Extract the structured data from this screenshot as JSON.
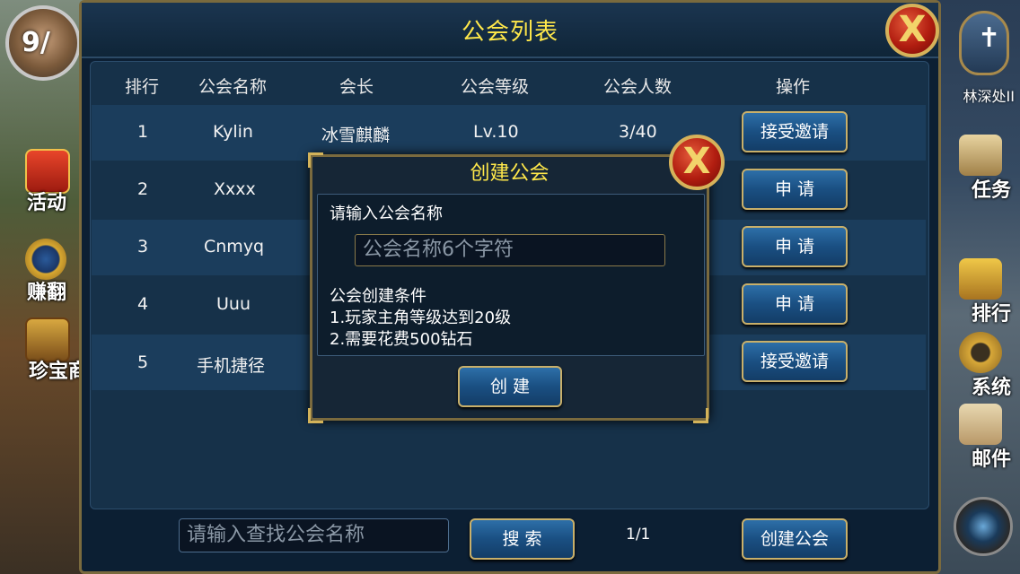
{
  "title": "公会列表",
  "close_symbol": "X",
  "left_side": {
    "avatar_logo": "9/",
    "items": [
      {
        "label": "活动"
      },
      {
        "label": "赚翻"
      },
      {
        "label": "珍宝商"
      }
    ]
  },
  "right_side": {
    "badge_label": "林深处II",
    "items": [
      {
        "label": "任务"
      },
      {
        "label": "排行"
      },
      {
        "label": "系统"
      },
      {
        "label": "邮件"
      }
    ]
  },
  "table": {
    "headers": [
      "排行",
      "公会名称",
      "会长",
      "公会等级",
      "公会人数",
      "操作"
    ],
    "rows": [
      {
        "rank": "1",
        "name": "Kylin",
        "leader": "冰雪麒麟",
        "level": "Lv.10",
        "members": "3/40",
        "action": "接受邀请"
      },
      {
        "rank": "2",
        "name": "Xxxx",
        "leader": "",
        "level": "",
        "members": "",
        "action": "申  请"
      },
      {
        "rank": "3",
        "name": "Cnmyq",
        "leader": "",
        "level": "",
        "members": "",
        "action": "申  请"
      },
      {
        "rank": "4",
        "name": "Uuu",
        "leader": "",
        "level": "",
        "members": "",
        "action": "申  请"
      },
      {
        "rank": "5",
        "name": "手机捷径",
        "leader": "",
        "level": "",
        "members": "",
        "action": "接受邀请"
      }
    ]
  },
  "footer": {
    "search_placeholder": "请输入查找公会名称",
    "search_button": "搜  索",
    "page": "1/1",
    "create_button": "创建公会"
  },
  "modal": {
    "title": "创建公会",
    "prompt": "请输入公会名称",
    "input_placeholder": "公会名称6个字符",
    "conditions_title": "公会创建条件",
    "conditions": [
      "1.玩家主角等级达到20级",
      "2.需要花费500钻石"
    ],
    "create_button": "创  建"
  },
  "colors": {
    "title": "#ffe84a",
    "panel": "#0c1f33",
    "button": "#1a4f82",
    "border_gold": "#c9b06a"
  }
}
